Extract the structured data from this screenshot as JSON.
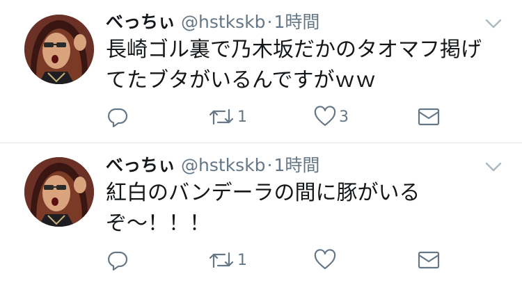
{
  "tweets": [
    {
      "display_name": "べっちぃ",
      "handle": "@hstkskb",
      "separator": "·",
      "time": "1時間",
      "text": "長崎ゴル裏で乃木坂だかのタオマフ掲げ\nてたブタがいるんですがｗｗ",
      "reply_count": "",
      "retweet_count": "1",
      "like_count": "3"
    },
    {
      "display_name": "べっちぃ",
      "handle": "@hstkskb",
      "separator": "·",
      "time": "1時間",
      "text": "紅白のバンデーラの間に豚がいる\nぞ〜！！！",
      "reply_count": "",
      "retweet_count": "1",
      "like_count": ""
    }
  ],
  "icons": {
    "reply": "reply-icon",
    "retweet": "retweet-icon",
    "like": "heart-icon",
    "dm": "envelope-icon",
    "menu": "chevron-down-icon"
  },
  "colors": {
    "text_primary": "#14171a",
    "text_secondary": "#657786",
    "divider": "#e1e8ed"
  }
}
